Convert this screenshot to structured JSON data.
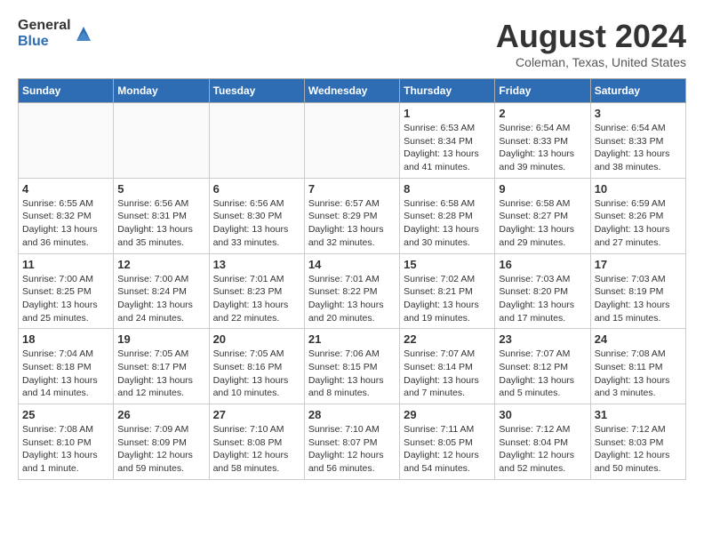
{
  "header": {
    "logo_general": "General",
    "logo_blue": "Blue",
    "month": "August 2024",
    "location": "Coleman, Texas, United States"
  },
  "weekdays": [
    "Sunday",
    "Monday",
    "Tuesday",
    "Wednesday",
    "Thursday",
    "Friday",
    "Saturday"
  ],
  "weeks": [
    [
      {
        "day": "",
        "info": ""
      },
      {
        "day": "",
        "info": ""
      },
      {
        "day": "",
        "info": ""
      },
      {
        "day": "",
        "info": ""
      },
      {
        "day": "1",
        "info": "Sunrise: 6:53 AM\nSunset: 8:34 PM\nDaylight: 13 hours\nand 41 minutes."
      },
      {
        "day": "2",
        "info": "Sunrise: 6:54 AM\nSunset: 8:33 PM\nDaylight: 13 hours\nand 39 minutes."
      },
      {
        "day": "3",
        "info": "Sunrise: 6:54 AM\nSunset: 8:33 PM\nDaylight: 13 hours\nand 38 minutes."
      }
    ],
    [
      {
        "day": "4",
        "info": "Sunrise: 6:55 AM\nSunset: 8:32 PM\nDaylight: 13 hours\nand 36 minutes."
      },
      {
        "day": "5",
        "info": "Sunrise: 6:56 AM\nSunset: 8:31 PM\nDaylight: 13 hours\nand 35 minutes."
      },
      {
        "day": "6",
        "info": "Sunrise: 6:56 AM\nSunset: 8:30 PM\nDaylight: 13 hours\nand 33 minutes."
      },
      {
        "day": "7",
        "info": "Sunrise: 6:57 AM\nSunset: 8:29 PM\nDaylight: 13 hours\nand 32 minutes."
      },
      {
        "day": "8",
        "info": "Sunrise: 6:58 AM\nSunset: 8:28 PM\nDaylight: 13 hours\nand 30 minutes."
      },
      {
        "day": "9",
        "info": "Sunrise: 6:58 AM\nSunset: 8:27 PM\nDaylight: 13 hours\nand 29 minutes."
      },
      {
        "day": "10",
        "info": "Sunrise: 6:59 AM\nSunset: 8:26 PM\nDaylight: 13 hours\nand 27 minutes."
      }
    ],
    [
      {
        "day": "11",
        "info": "Sunrise: 7:00 AM\nSunset: 8:25 PM\nDaylight: 13 hours\nand 25 minutes."
      },
      {
        "day": "12",
        "info": "Sunrise: 7:00 AM\nSunset: 8:24 PM\nDaylight: 13 hours\nand 24 minutes."
      },
      {
        "day": "13",
        "info": "Sunrise: 7:01 AM\nSunset: 8:23 PM\nDaylight: 13 hours\nand 22 minutes."
      },
      {
        "day": "14",
        "info": "Sunrise: 7:01 AM\nSunset: 8:22 PM\nDaylight: 13 hours\nand 20 minutes."
      },
      {
        "day": "15",
        "info": "Sunrise: 7:02 AM\nSunset: 8:21 PM\nDaylight: 13 hours\nand 19 minutes."
      },
      {
        "day": "16",
        "info": "Sunrise: 7:03 AM\nSunset: 8:20 PM\nDaylight: 13 hours\nand 17 minutes."
      },
      {
        "day": "17",
        "info": "Sunrise: 7:03 AM\nSunset: 8:19 PM\nDaylight: 13 hours\nand 15 minutes."
      }
    ],
    [
      {
        "day": "18",
        "info": "Sunrise: 7:04 AM\nSunset: 8:18 PM\nDaylight: 13 hours\nand 14 minutes."
      },
      {
        "day": "19",
        "info": "Sunrise: 7:05 AM\nSunset: 8:17 PM\nDaylight: 13 hours\nand 12 minutes."
      },
      {
        "day": "20",
        "info": "Sunrise: 7:05 AM\nSunset: 8:16 PM\nDaylight: 13 hours\nand 10 minutes."
      },
      {
        "day": "21",
        "info": "Sunrise: 7:06 AM\nSunset: 8:15 PM\nDaylight: 13 hours\nand 8 minutes."
      },
      {
        "day": "22",
        "info": "Sunrise: 7:07 AM\nSunset: 8:14 PM\nDaylight: 13 hours\nand 7 minutes."
      },
      {
        "day": "23",
        "info": "Sunrise: 7:07 AM\nSunset: 8:12 PM\nDaylight: 13 hours\nand 5 minutes."
      },
      {
        "day": "24",
        "info": "Sunrise: 7:08 AM\nSunset: 8:11 PM\nDaylight: 13 hours\nand 3 minutes."
      }
    ],
    [
      {
        "day": "25",
        "info": "Sunrise: 7:08 AM\nSunset: 8:10 PM\nDaylight: 13 hours\nand 1 minute."
      },
      {
        "day": "26",
        "info": "Sunrise: 7:09 AM\nSunset: 8:09 PM\nDaylight: 12 hours\nand 59 minutes."
      },
      {
        "day": "27",
        "info": "Sunrise: 7:10 AM\nSunset: 8:08 PM\nDaylight: 12 hours\nand 58 minutes."
      },
      {
        "day": "28",
        "info": "Sunrise: 7:10 AM\nSunset: 8:07 PM\nDaylight: 12 hours\nand 56 minutes."
      },
      {
        "day": "29",
        "info": "Sunrise: 7:11 AM\nSunset: 8:05 PM\nDaylight: 12 hours\nand 54 minutes."
      },
      {
        "day": "30",
        "info": "Sunrise: 7:12 AM\nSunset: 8:04 PM\nDaylight: 12 hours\nand 52 minutes."
      },
      {
        "day": "31",
        "info": "Sunrise: 7:12 AM\nSunset: 8:03 PM\nDaylight: 12 hours\nand 50 minutes."
      }
    ]
  ]
}
